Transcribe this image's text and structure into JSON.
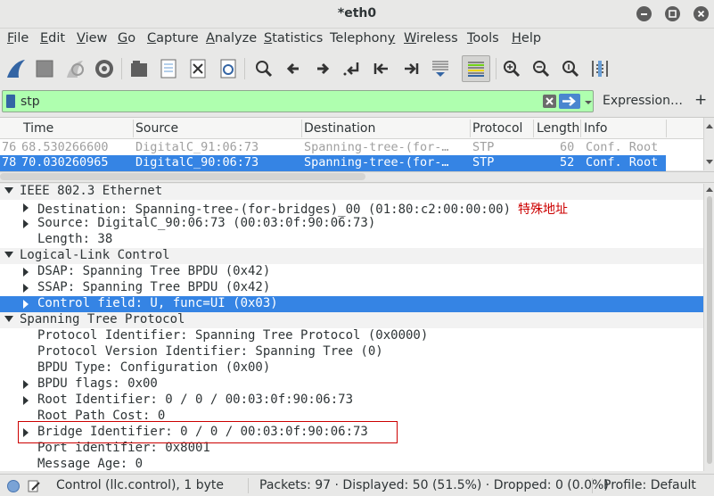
{
  "window": {
    "title": "*eth0"
  },
  "menu": [
    "File",
    "Edit",
    "View",
    "Go",
    "Capture",
    "Analyze",
    "Statistics",
    "Telephony",
    "Wireless",
    "Tools",
    "Help"
  ],
  "menu_mnemonics": [
    "F",
    "E",
    "V",
    "G",
    "C",
    "A",
    "S",
    "y",
    "W",
    "T",
    "H"
  ],
  "toolbar_icons": [
    "shark-fin-start-icon",
    "stop-capture-icon",
    "restart-capture-icon",
    "capture-options-icon",
    "open-file-icon",
    "save-file-icon",
    "close-file-icon",
    "reload-file-icon",
    "find-packet-icon",
    "go-back-icon",
    "go-forward-icon",
    "go-to-packet-icon",
    "go-first-icon",
    "go-last-icon",
    "autoscroll-icon",
    "colorize-icon",
    "zoom-in-icon",
    "zoom-out-icon",
    "normal-size-icon",
    "resize-columns-icon"
  ],
  "filter": {
    "value": "stp",
    "expression_label": "Expression…",
    "add_label": "+"
  },
  "packet_list": {
    "columns": [
      "Time",
      "Source",
      "Destination",
      "Protocol",
      "Length",
      "Info"
    ],
    "rows": [
      {
        "no": "76",
        "time": "68.530266600",
        "source": "DigitalC_91:06:73",
        "destination": "Spanning-tree-(for-…",
        "protocol": "STP",
        "length": "60",
        "info": "Conf. Root",
        "selected": false
      },
      {
        "no": "78",
        "time": "70.030260965",
        "source": "DigitalC_90:06:73",
        "destination": "Spanning-tree-(for-…",
        "protocol": "STP",
        "length": "52",
        "info": "Conf. Root",
        "selected": true
      }
    ]
  },
  "details": [
    {
      "text": "IEEE 802.3 Ethernet",
      "indent": 0,
      "toggle": "open",
      "section": true
    },
    {
      "text": "Destination: Spanning-tree-(for-bridges)_00 (01:80:c2:00:00:00)",
      "annotation": "特殊地址",
      "indent": 1,
      "toggle": "closed"
    },
    {
      "text": "Source: DigitalC_90:06:73 (00:03:0f:90:06:73)",
      "indent": 1,
      "toggle": "closed"
    },
    {
      "text": "Length: 38",
      "indent": 1,
      "toggle": "none"
    },
    {
      "text": "Logical-Link Control",
      "indent": 0,
      "toggle": "open",
      "section": true
    },
    {
      "text": "DSAP: Spanning Tree BPDU (0x42)",
      "indent": 1,
      "toggle": "closed"
    },
    {
      "text": "SSAP: Spanning Tree BPDU (0x42)",
      "indent": 1,
      "toggle": "closed"
    },
    {
      "text": "Control field: U, func=UI (0x03)",
      "indent": 1,
      "toggle": "closed",
      "selected": true
    },
    {
      "text": "Spanning Tree Protocol",
      "indent": 0,
      "toggle": "open",
      "section": true
    },
    {
      "text": "Protocol Identifier: Spanning Tree Protocol (0x0000)",
      "indent": 1,
      "toggle": "none"
    },
    {
      "text": "Protocol Version Identifier: Spanning Tree (0)",
      "indent": 1,
      "toggle": "none"
    },
    {
      "text": "BPDU Type: Configuration (0x00)",
      "indent": 1,
      "toggle": "none"
    },
    {
      "text": "BPDU flags: 0x00",
      "indent": 1,
      "toggle": "closed"
    },
    {
      "text": "Root Identifier: 0 / 0 / 00:03:0f:90:06:73",
      "indent": 1,
      "toggle": "closed"
    },
    {
      "text": "Root Path Cost: 0",
      "indent": 1,
      "toggle": "none"
    },
    {
      "text": "Bridge Identifier: 0 / 0 / 00:03:0f:90:06:73",
      "indent": 1,
      "toggle": "closed",
      "highlighted": true
    },
    {
      "text": "Port identifier: 0x8001",
      "indent": 1,
      "toggle": "none"
    },
    {
      "text": "Message Age: 0",
      "indent": 1,
      "toggle": "none"
    }
  ],
  "status": {
    "field": "Control (llc.control), 1 byte",
    "packets": "Packets: 97 · Displayed: 50 (51.5%) · Dropped: 0 (0.0%)",
    "profile": "Profile: Default"
  },
  "colors": {
    "selection": "#3584e4",
    "filter_ok": "#afffaf",
    "annotation": "#cc0000"
  }
}
